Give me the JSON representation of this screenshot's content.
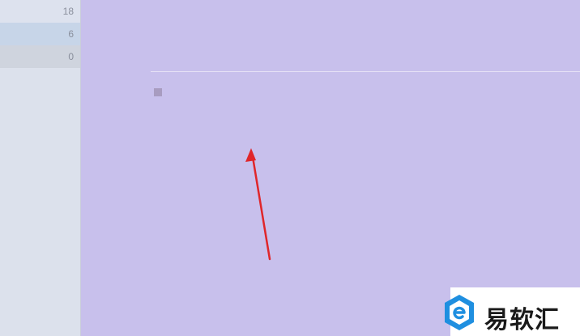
{
  "sidebar": {
    "counts": [
      "18",
      "6",
      "0"
    ]
  },
  "main": {
    "checkbox_checked": false
  },
  "watermark": {
    "text": "易软汇",
    "logo_icon": "hexagon-e-logo",
    "colors": {
      "logo_blue": "#1f8fe0",
      "bg": "#ffffff"
    }
  },
  "annotation": {
    "arrow_color": "#e0262a"
  }
}
